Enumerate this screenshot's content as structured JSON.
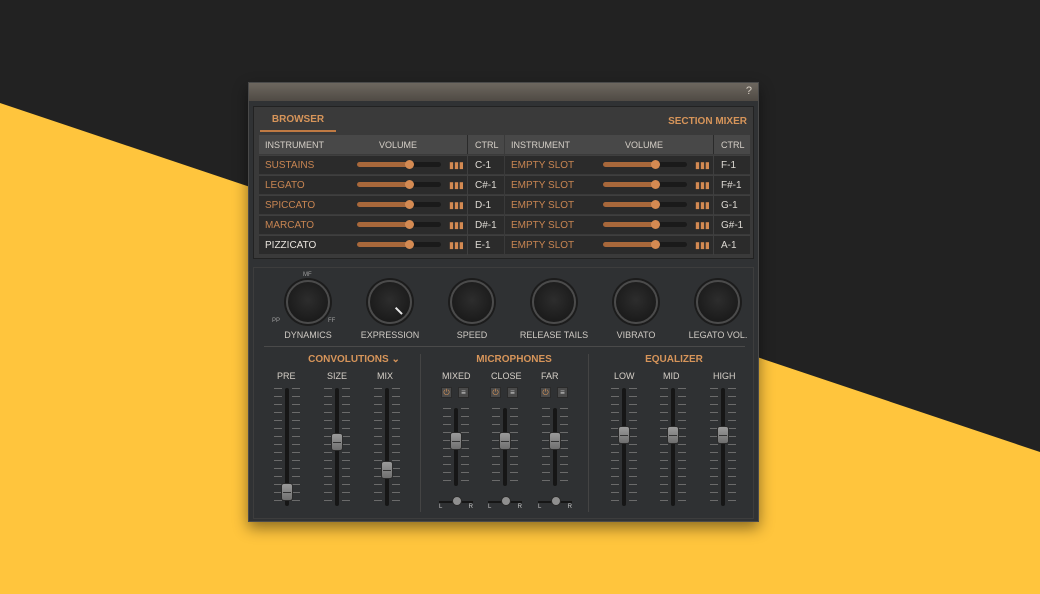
{
  "window": {
    "help_label": "?"
  },
  "colors": {
    "background": "#222222",
    "accent_yellow": "#ffc53d",
    "accent_copper": "#d7955a"
  },
  "tabs": {
    "browser": "BROWSER",
    "section_mixer": "SECTION MIXER"
  },
  "columns": {
    "instrument": "INSTRUMENT",
    "volume": "VOLUME",
    "ctrl": "CTRL"
  },
  "left_rows": [
    {
      "name": "SUSTAINS",
      "ctrl": "C-1",
      "volume": 0.62
    },
    {
      "name": "LEGATO",
      "ctrl": "C#-1",
      "volume": 0.62
    },
    {
      "name": "SPICCATO",
      "ctrl": "D-1",
      "volume": 0.62
    },
    {
      "name": "MARCATO",
      "ctrl": "D#-1",
      "volume": 0.62
    },
    {
      "name": "PIZZICATO",
      "ctrl": "E-1",
      "volume": 0.62
    }
  ],
  "right_rows": [
    {
      "name": "EMPTY SLOT",
      "ctrl": "F-1",
      "volume": 0.62
    },
    {
      "name": "EMPTY SLOT",
      "ctrl": "F#-1",
      "volume": 0.62
    },
    {
      "name": "EMPTY SLOT",
      "ctrl": "G-1",
      "volume": 0.62
    },
    {
      "name": "EMPTY SLOT",
      "ctrl": "G#-1",
      "volume": 0.62
    },
    {
      "name": "EMPTY SLOT",
      "ctrl": "A-1",
      "volume": 0.62
    }
  ],
  "knobs": [
    {
      "label": "DYNAMICS",
      "pp": "PP",
      "mf": "MF",
      "ff": "FF"
    },
    {
      "label": "EXPRESSION"
    },
    {
      "label": "SPEED"
    },
    {
      "label": "RELEASE TAILS"
    },
    {
      "label": "VIBRATO"
    },
    {
      "label": "LEGATO VOL."
    }
  ],
  "groups": {
    "convolutions": {
      "title": "CONVOLUTIONS",
      "faders": [
        {
          "label": "PRE",
          "level": 0.05
        },
        {
          "label": "SIZE",
          "level": 0.55
        },
        {
          "label": "MIX",
          "level": 0.27
        }
      ]
    },
    "microphones": {
      "title": "MICROPHONES",
      "channels": [
        {
          "label": "MIXED",
          "level": 0.6
        },
        {
          "label": "CLOSE",
          "level": 0.6
        },
        {
          "label": "FAR",
          "level": 0.6
        }
      ],
      "pan_l": "L",
      "pan_r": "R"
    },
    "equalizer": {
      "title": "EQUALIZER",
      "faders": [
        {
          "label": "LOW",
          "level": 0.62
        },
        {
          "label": "MID",
          "level": 0.62
        },
        {
          "label": "HIGH",
          "level": 0.62
        }
      ]
    }
  }
}
